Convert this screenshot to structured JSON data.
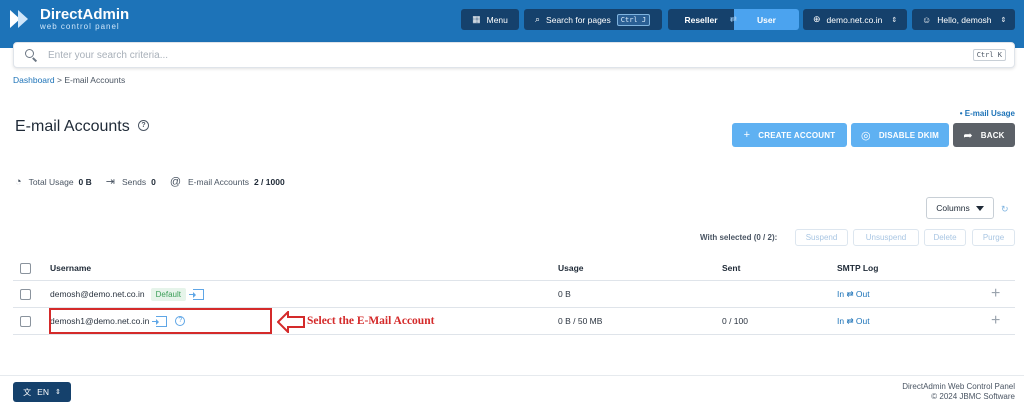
{
  "header": {
    "logo_title": "DirectAdmin",
    "logo_subtitle": "web control panel",
    "menu_label": "Menu",
    "search_pages_label": "Search for pages",
    "search_pages_shortcut": "Ctrl J",
    "role_reseller": "Reseller",
    "role_user": "User",
    "domain_selector": "demo.net.co.in",
    "user_greeting": "Hello, demosh"
  },
  "search": {
    "placeholder": "Enter your search criteria...",
    "shortcut": "Ctrl K"
  },
  "breadcrumb": {
    "root": "Dashboard",
    "separator": ">",
    "current": "E-mail Accounts"
  },
  "page": {
    "title": "E-mail Accounts",
    "email_usage_link": "• E-mail Usage",
    "create_account": "CREATE ACCOUNT",
    "disable_dkim": "DISABLE DKIM",
    "back": "BACK"
  },
  "stats": {
    "total_usage_label": "Total Usage",
    "total_usage_value": "0 B",
    "sends_label": "Sends",
    "sends_value": "0",
    "accounts_label": "E-mail Accounts",
    "accounts_value": "2 / 1000"
  },
  "toolbar": {
    "columns_label": "Columns",
    "with_selected": "With selected (0 / 2):",
    "suspend": "Suspend",
    "unsuspend": "Unsuspend",
    "delete": "Delete",
    "purge": "Purge"
  },
  "table": {
    "headers": {
      "username": "Username",
      "usage": "Usage",
      "sent": "Sent",
      "smtp_log": "SMTP Log"
    },
    "rows": [
      {
        "username": "demosh@demo.net.co.in",
        "badge": "Default",
        "usage": "0 B",
        "sent": "",
        "smtp": "In ⇄ Out"
      },
      {
        "username": "demosh1@demo.net.co.in",
        "badge": "",
        "usage": "0 B / 50 MB",
        "sent": "0 / 100",
        "smtp": "In ⇄ Out"
      }
    ]
  },
  "annotation": {
    "text": "Select the E-Mail Account",
    "color": "#d42a2a"
  },
  "footer": {
    "language": "EN",
    "product": "DirectAdmin Web Control Panel",
    "copyright": "© 2024 JBMC Software"
  },
  "colors": {
    "brand": "#1d73b8",
    "navy": "#15416c",
    "accent": "#5fb1f2"
  }
}
